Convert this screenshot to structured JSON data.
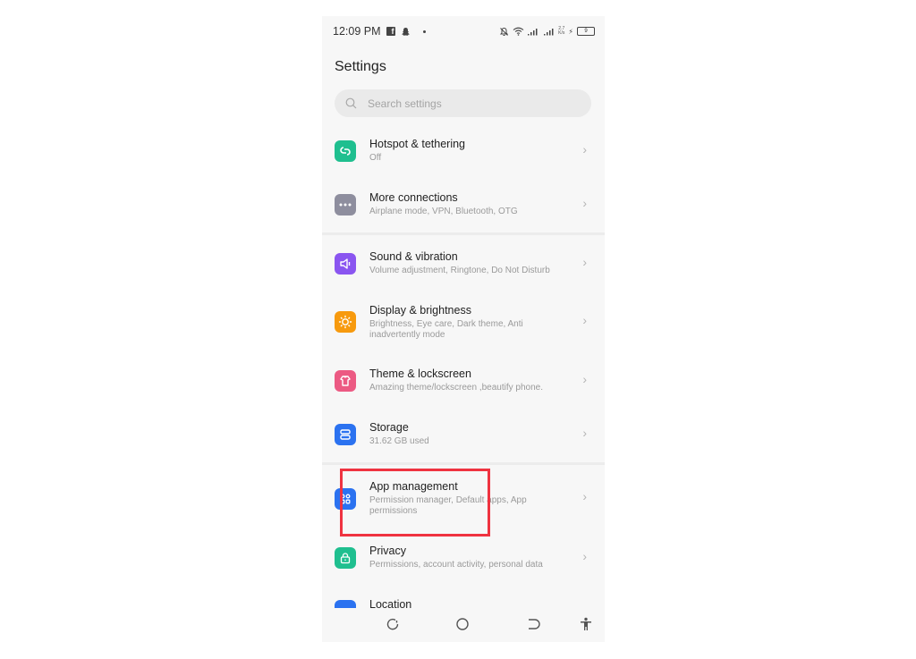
{
  "status_bar": {
    "time": "12:09 PM",
    "notification_icons": [
      "facebook-icon",
      "snapchat-icon",
      "dot-icon"
    ],
    "system_icons": [
      "mute-icon",
      "wifi-icon",
      "signal-icon",
      "signal-icon-2"
    ],
    "network_speed_top": "2.7",
    "network_speed_bottom": "K/s",
    "battery_level": "9"
  },
  "header": {
    "title": "Settings"
  },
  "search": {
    "placeholder": "Search settings"
  },
  "settings_items": [
    {
      "title": "Hotspot & tethering",
      "subtitle": "Off",
      "icon": "hotspot-icon",
      "color": "#1fbf8f"
    },
    {
      "title": "More connections",
      "subtitle": "Airplane mode, VPN, Bluetooth, OTG",
      "icon": "more-icon",
      "color": "#8e8e9e"
    },
    {
      "title": "Sound & vibration",
      "subtitle": "Volume adjustment, Ringtone, Do Not Disturb",
      "icon": "speaker-icon",
      "color": "#8a55f0"
    },
    {
      "title": "Display & brightness",
      "subtitle": "Brightness, Eye care, Dark theme, Anti inadvertently mode",
      "icon": "brightness-icon",
      "color": "#f79a0e"
    },
    {
      "title": "Theme & lockscreen",
      "subtitle": "Amazing theme/lockscreen ,beautify phone.",
      "icon": "theme-icon",
      "color": "#ec5a83"
    },
    {
      "title": "Storage",
      "subtitle": "31.62 GB used",
      "icon": "storage-icon",
      "color": "#2b72f0"
    },
    {
      "title": "App management",
      "subtitle": "Permission manager, Default apps, App permissions",
      "icon": "apps-icon",
      "color": "#2b72f0"
    },
    {
      "title": "Privacy",
      "subtitle": "Permissions, account activity, personal data",
      "icon": "lock-icon",
      "color": "#1fbf8f"
    },
    {
      "title": "Location",
      "subtitle": "",
      "icon": "location-icon",
      "color": "#2b72f0"
    }
  ],
  "nav_bar": {
    "buttons": [
      "recents",
      "home",
      "back",
      "accessibility"
    ]
  },
  "annotation": {
    "highlight_color": "#ef3340",
    "highlighted_item": "App management"
  }
}
